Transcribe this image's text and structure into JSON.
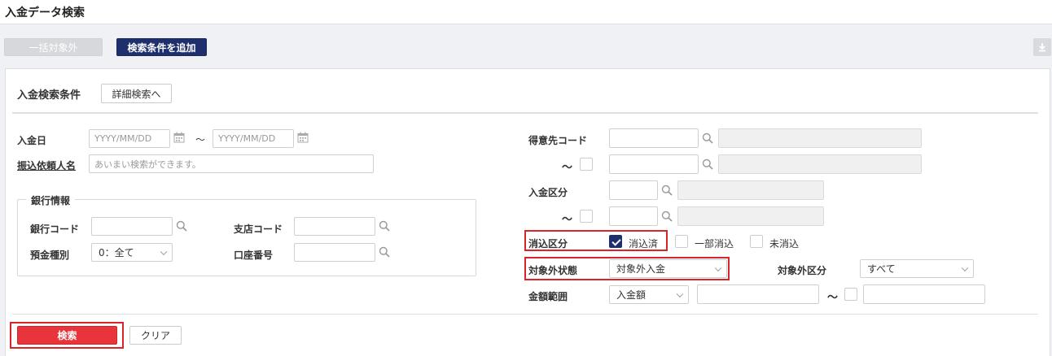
{
  "page": {
    "title": "入金データ検索"
  },
  "toolbar": {
    "exclude_all_label": "一括対象外",
    "add_condition_label": "検索条件を追加"
  },
  "panel": {
    "heading": "入金検索条件",
    "detail_button_label": "詳細検索へ"
  },
  "payment_date": {
    "label": "入金日",
    "from_placeholder": "YYYY/MM/DD",
    "to_placeholder": "YYYY/MM/DD",
    "tilde": "～"
  },
  "transfer_name": {
    "label": "振込依頼人名",
    "placeholder": "あいまい検索ができます。"
  },
  "bank_info": {
    "legend": "銀行情報",
    "bank_code_label": "銀行コード",
    "branch_code_label": "支店コード",
    "deposit_type_label": "預金種別",
    "deposit_type_value": "0：全て",
    "account_no_label": "口座番号"
  },
  "customer_code": {
    "label": "得意先コード",
    "tilde": "～"
  },
  "payment_type": {
    "label": "入金区分",
    "tilde": "～"
  },
  "clearing": {
    "label": "消込区分",
    "options": [
      {
        "label": "消込済",
        "checked": true
      },
      {
        "label": "一部消込",
        "checked": false
      },
      {
        "label": "未消込",
        "checked": false
      }
    ]
  },
  "exclusion_status": {
    "label": "対象外状態",
    "value": "対象外入金"
  },
  "exclusion_type": {
    "label": "対象外区分",
    "value": "すべて"
  },
  "amount_range": {
    "label": "金額範囲",
    "type_value": "入金額",
    "tilde": "～"
  },
  "actions": {
    "search_label": "検索",
    "clear_label": "クリア"
  },
  "colors": {
    "navy": "#1f2f6e",
    "red": "#e8353b",
    "highlight": "#d9242b"
  }
}
